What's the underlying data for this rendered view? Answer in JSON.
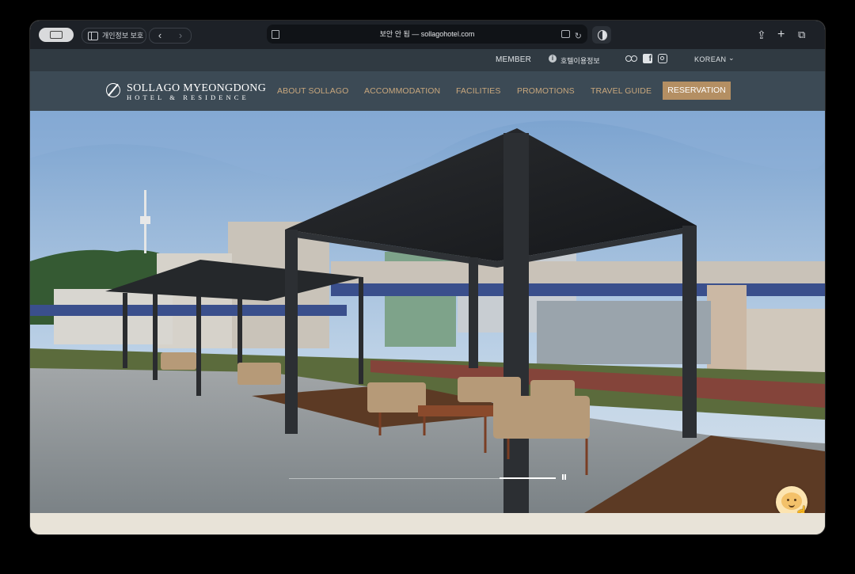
{
  "browser": {
    "privacy_label": "개인정보 보호",
    "url_text": "보안 안 됨 — sollagohotel.com",
    "icons": [
      "sidebar-icon",
      "back-icon",
      "forward-icon",
      "page-icon",
      "translate-icon",
      "reload-icon",
      "shield-icon",
      "share-icon",
      "new-tab-icon",
      "tabs-icon"
    ]
  },
  "utility_bar": {
    "member": "MEMBER",
    "hotel_info": "호텔이용정보",
    "language": "KOREAN"
  },
  "header": {
    "logo_name": "SOLLAGO MYEONGDONG",
    "logo_sub": "HOTEL & RESIDENCE",
    "menu": [
      "ABOUT SOLLAGO",
      "ACCOMMODATION",
      "FACILITIES",
      "PROMOTIONS",
      "TRAVEL GUIDE"
    ],
    "reservation": "RESERVATION"
  },
  "hero": {
    "slider_progress": 0.21,
    "state": "playing"
  },
  "colors": {
    "nav_bg": "#3c4a55",
    "util_bg": "#303a42",
    "menu_text": "#c8a77d",
    "reservation_bg": "#b48f63"
  }
}
